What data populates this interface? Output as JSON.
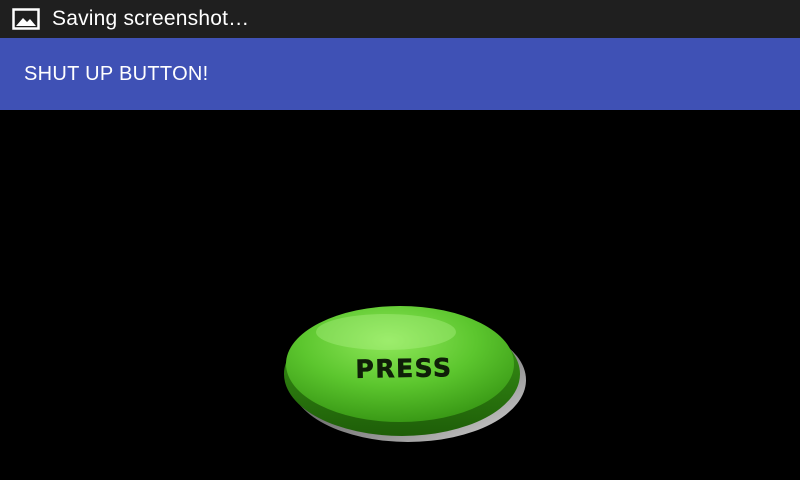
{
  "status_bar": {
    "icon": "image-icon",
    "text": "Saving screenshot…"
  },
  "app_bar": {
    "title": "SHUT UP BUTTON!",
    "color": "#3f51b5"
  },
  "main": {
    "button": {
      "label": "PRESS",
      "color": "#5cc62e"
    }
  }
}
